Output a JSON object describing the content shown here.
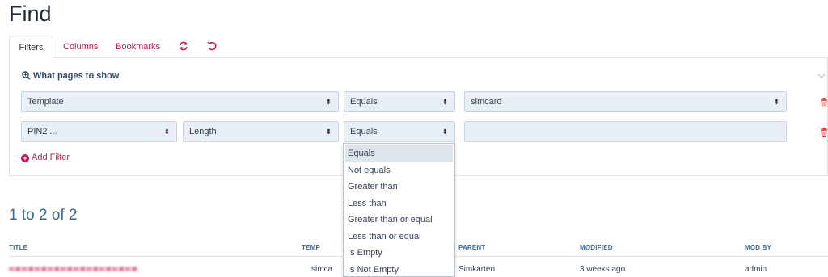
{
  "page": {
    "title": "Find"
  },
  "tabs": [
    {
      "label": "Filters"
    },
    {
      "label": "Columns"
    },
    {
      "label": "Bookmarks"
    }
  ],
  "tab_icons": [
    "refresh-icon",
    "undo-icon"
  ],
  "filters_section": {
    "heading": "What pages to show",
    "rows": [
      {
        "field": "Template",
        "operator": "Equals",
        "value": "simcard"
      },
      {
        "field": "PIN2 ...",
        "subfield": "Length",
        "operator": "Equals",
        "value": ""
      }
    ],
    "add_filter_label": "Add Filter"
  },
  "operator_dropdown": {
    "options": [
      "Equals",
      "Not equals",
      "Greater than",
      "Less than",
      "Greater than or equal",
      "Less than or equal",
      "Is Empty",
      "Is Not Empty"
    ],
    "selected": "Equals"
  },
  "results": {
    "count_text": "1 to 2 of 2",
    "columns": [
      "TITLE",
      "TEMP",
      "PARENT",
      "MODIFIED",
      "MOD BY"
    ],
    "rows": [
      {
        "title": "",
        "template": "simca",
        "parent": "Simkarten",
        "modified": "3 weeks ago",
        "mod_by": "admin"
      }
    ]
  },
  "colors": {
    "accent": "#c2185b",
    "heading_blue": "#3a6a94",
    "select_bg": "#e9eff6"
  }
}
